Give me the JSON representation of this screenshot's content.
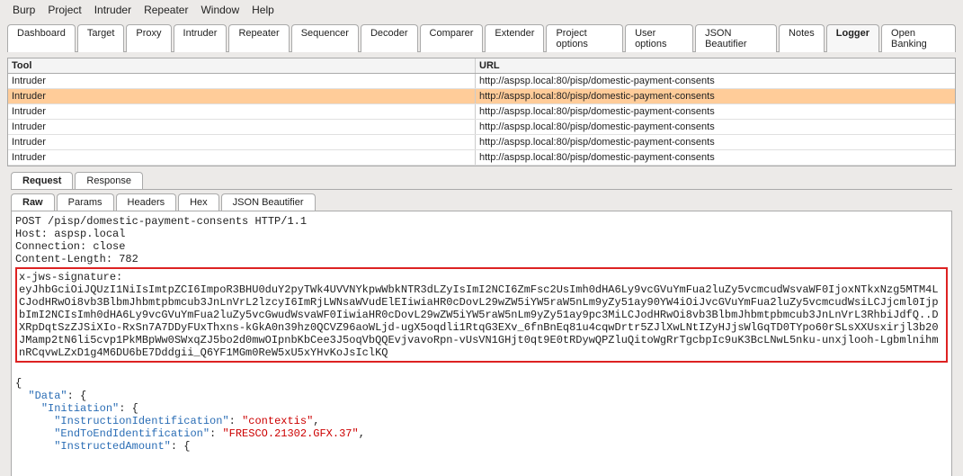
{
  "menu": [
    "Burp",
    "Project",
    "Intruder",
    "Repeater",
    "Window",
    "Help"
  ],
  "main_tabs": {
    "items": [
      "Dashboard",
      "Target",
      "Proxy",
      "Intruder",
      "Repeater",
      "Sequencer",
      "Decoder",
      "Comparer",
      "Extender",
      "Project options",
      "User options",
      "JSON Beautifier",
      "Notes",
      "Logger",
      "Open Banking"
    ],
    "active_index": 13
  },
  "table": {
    "columns": [
      "Tool",
      "URL"
    ],
    "rows": [
      {
        "tool": "Intruder",
        "url": "http://aspsp.local:80/pisp/domestic-payment-consents"
      },
      {
        "tool": "Intruder",
        "url": "http://aspsp.local:80/pisp/domestic-payment-consents"
      },
      {
        "tool": "Intruder",
        "url": "http://aspsp.local:80/pisp/domestic-payment-consents"
      },
      {
        "tool": "Intruder",
        "url": "http://aspsp.local:80/pisp/domestic-payment-consents"
      },
      {
        "tool": "Intruder",
        "url": "http://aspsp.local:80/pisp/domestic-payment-consents"
      },
      {
        "tool": "Intruder",
        "url": "http://aspsp.local:80/pisp/domestic-payment-consents"
      }
    ],
    "selected_index": 1
  },
  "rr_tabs": {
    "items": [
      "Request",
      "Response"
    ],
    "active_index": 0
  },
  "fmt_tabs": {
    "items": [
      "Raw",
      "Params",
      "Headers",
      "Hex",
      "JSON Beautifier"
    ],
    "active_index": 0
  },
  "request": {
    "header_lines": [
      "POST /pisp/domestic-payment-consents HTTP/1.1",
      "Host: aspsp.local",
      "Connection: close",
      "Content-Length: 782"
    ],
    "highlight_lines": [
      "x-jws-signature:",
      "eyJhbGciOiJQUzI1NiIsImtpZCI6ImpoR3BHU0duY2pyTWk4UVVNYkpwWbkNTR3dLZyIsImI2NCI6ZmFsc2UsImh0dHA6Ly9vcGVuYmFua2luZy5vcmcudWsvaWF0IjoxNTkxNzg5MTM4LCJodHRwOi8vb3BlbmJhbmtpbmcub3JnLnVrL2lzcyI6ImRjLWNsaWVudElEIiwiaHR0cDovL29wZW5iYW5raW5nLm9yZy51ay90YW4iOiJvcGVuYmFua2luZy5vcmcudWsiLCJjcml0IjpbImI2NCIsImh0dHA6Ly9vcGVuYmFua2luZy5vcGwudWsvaWF0IiwiaHR0cDovL29wZW5iYW5raW5nLm9yZy51ay9pc3MiLCJodHRwOi8vb3BlbmJhbmtpbmcub3JnLnVrL3RhbiJdfQ..DXRpDqtSzZJSiXIo-RxSn7A7DDyFUxThxns-kGkA0n39hz0QCVZ96aoWLjd-ugX5oqdli1RtqG3EXv_6fnBnEq81u4cqwDrtr5ZJlXwLNtIZyHJjsWlGqTD0TYpo60rSLsXXUsxirjl3b20JMamp2tN6li5cvp1PkMBpWw0SWxqZJ5bo2d0mwOIpnbKbCee3J5oqVbQQEvjvavoRpn-vUsVN1GHjt0qt9E0tRDywQPZluQitoWgRrTgcbpIc9uK3BcLNwL5nku-unxjlooh-LgbmlnihmnRCqvwLZxD1g4M6DU6bE7Dddgii_Q6YF1MGm0ReW5xU5xYHvKoJsIclKQ"
    ],
    "json_lines": [
      {
        "text": "{",
        "indent": 0
      },
      {
        "key": "Data",
        "suffix": ": {",
        "indent": 1
      },
      {
        "key": "Initiation",
        "suffix": ": {",
        "indent": 2
      },
      {
        "key": "InstructionIdentification",
        "value": "contextis",
        "trail": ",",
        "indent": 3
      },
      {
        "key": "EndToEndIdentification",
        "value": "FRESCO.21302.GFX.37",
        "trail": ",",
        "indent": 3
      },
      {
        "key": "InstructedAmount",
        "suffix": ": {",
        "indent": 3
      }
    ]
  }
}
